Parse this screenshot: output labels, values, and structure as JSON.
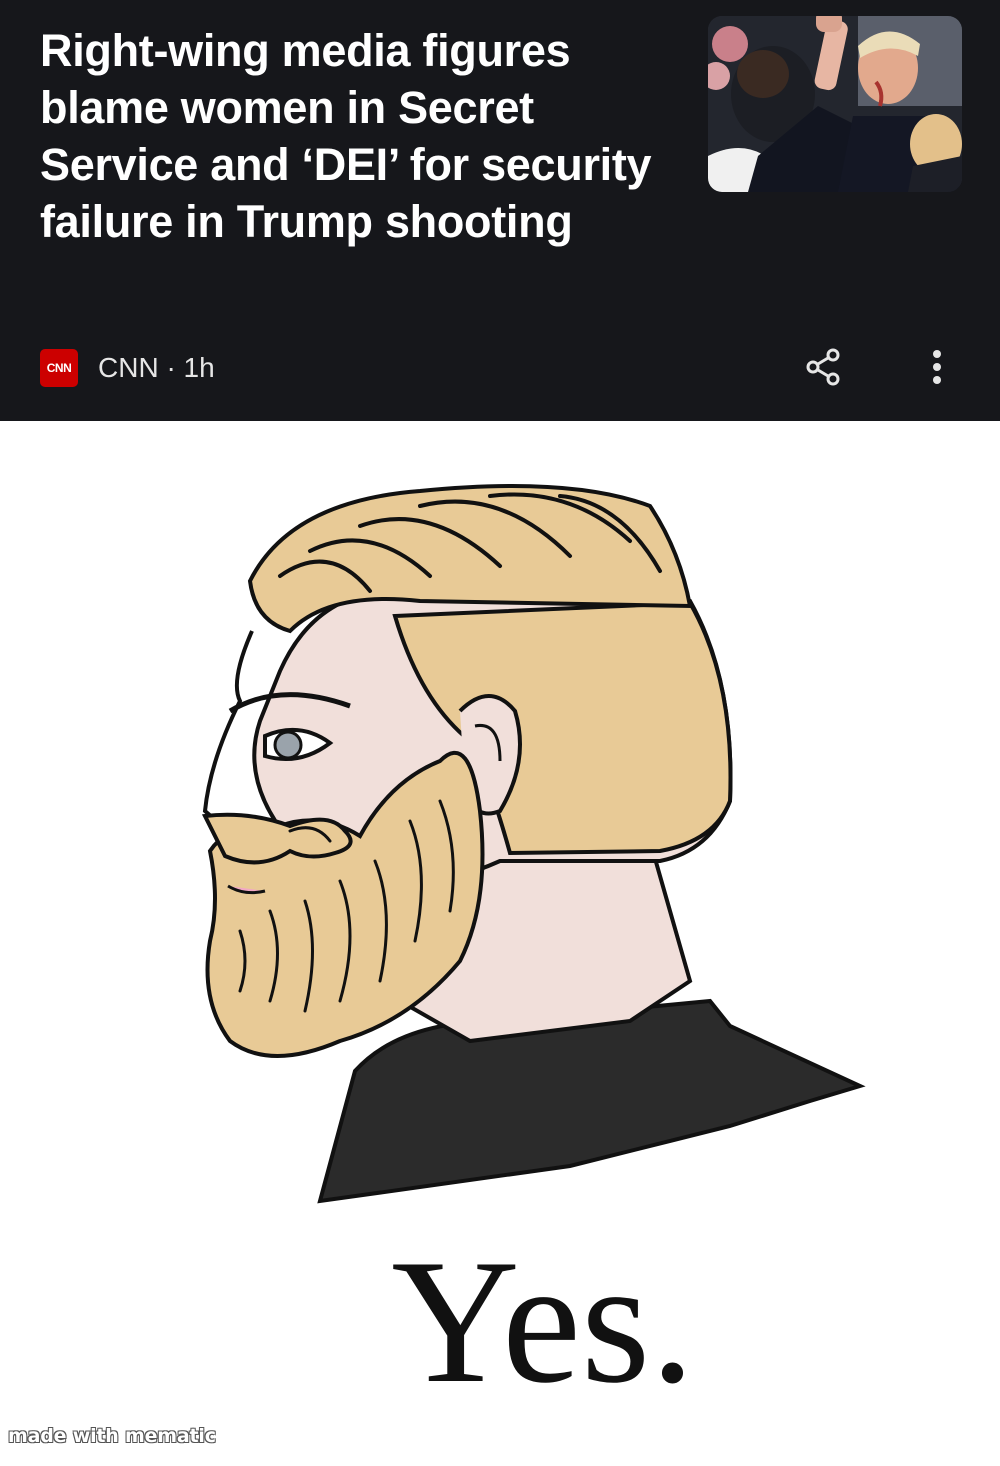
{
  "news_card": {
    "headline": "Right-wing media figures blame women in Secret Service and ‘DEI’ for security failure in Trump shooting",
    "source_logo": "CNN",
    "source_meta": "CNN · 1h",
    "share_icon": "share-icon",
    "more_icon": "more-vert-icon"
  },
  "meme": {
    "caption": "Yes.",
    "watermark": "made with mematic"
  },
  "colors": {
    "card_background": "#16171b",
    "cnn_red": "#cc0000",
    "hair_beard": "#e8ca96",
    "skin": "#f1dfda",
    "shirt": "#2b2b2b"
  }
}
